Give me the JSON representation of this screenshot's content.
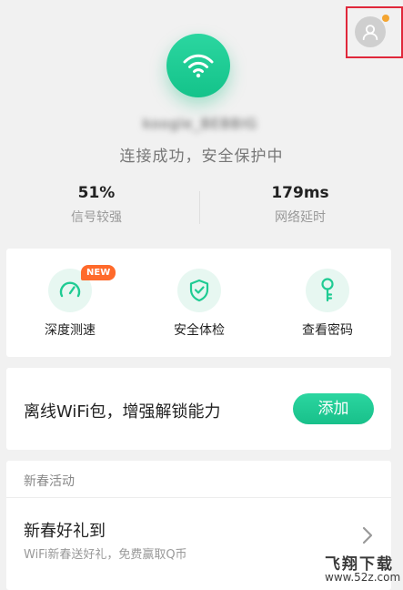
{
  "header": {
    "network_name": "koogle_BEBBIG",
    "status": "连接成功，安全保护中"
  },
  "stats": {
    "signal_value": "51%",
    "signal_label": "信号较强",
    "latency_value": "179ms",
    "latency_label": "网络延时"
  },
  "tools": {
    "badge_new": "NEW",
    "items": [
      {
        "label": "深度测速",
        "icon": "speedometer-icon"
      },
      {
        "label": "安全体检",
        "icon": "shield-check-icon"
      },
      {
        "label": "查看密码",
        "icon": "key-icon"
      }
    ]
  },
  "offline": {
    "text": "离线WiFi包，增强解锁能力",
    "button": "添加"
  },
  "activity": {
    "header": "新春活动",
    "title": "新春好礼到",
    "subtitle": "WiFi新春送好礼，免费赢取Q币"
  },
  "watermark": {
    "title": "飞翔下载",
    "url": "www.52z.com"
  },
  "colors": {
    "accent": "#1fcb93",
    "badge": "#ff6a2b",
    "highlight_box": "#e0283b"
  }
}
